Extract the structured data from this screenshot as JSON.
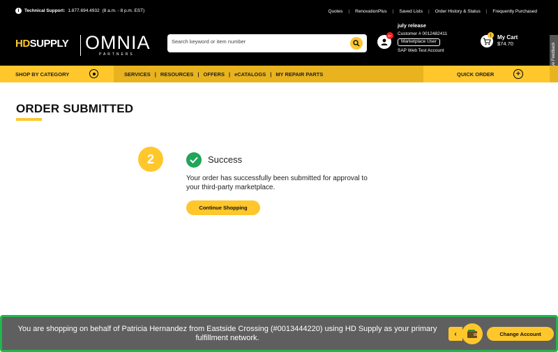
{
  "topbar": {
    "support_label": "Technical Support:",
    "support_phone": "1.877.694.4932",
    "support_hours": "(8 a.m. - 8 p.m. EST)",
    "links": [
      "Quotes",
      "RenovationPlus",
      "Saved Lists",
      "Order History & Status",
      "Frequently Purchased"
    ]
  },
  "header": {
    "logo_hd": "HD",
    "logo_supply": "SUPPLY",
    "logo_omnia": "OMNIA",
    "logo_partners": "PARTNERS",
    "search_placeholder": "Search keyword or item number",
    "account_badge": "9+",
    "account_name": "july release",
    "customer_number": "Customer # 0012482411",
    "account_role": "Marketplace User",
    "account_type": "SAP Web Test Account",
    "cart_badge": "1",
    "cart_label": "My Cart",
    "cart_total": "$74.70",
    "feedback_label": "Give Feedback"
  },
  "nav": {
    "shop_by_category": "SHOP BY CATEGORY",
    "links": [
      "SERVICES",
      "RESOURCES",
      "OFFERS",
      "eCATALOGS",
      "MY REPAIR PARTS"
    ],
    "separator": "|",
    "quick_order": "QUICK ORDER"
  },
  "main": {
    "title": "ORDER SUBMITTED",
    "step_number": "2",
    "status": "Success",
    "message": "Your order has successfully been submitted for approval to your third-party marketplace.",
    "continue_button": "Continue Shopping"
  },
  "banner": {
    "text": "You are shopping on behalf of Patricia Hernandez from Eastside Crossing (#0013444220) using HD Supply as your primary fulfillment network.",
    "change_button": "Change Account"
  },
  "colors": {
    "brand_yellow": "#ffc72c",
    "nav_gold": "#e8b31e",
    "success_green": "#22a55a",
    "banner_border": "#1fb84a",
    "banner_bg": "#5f5f5f"
  },
  "icons": [
    "info-icon",
    "search-icon",
    "account-icon",
    "cart-icon",
    "category-circle-icon",
    "plus-circle-icon",
    "check-icon",
    "chevron-left-icon",
    "wallet-icon"
  ]
}
